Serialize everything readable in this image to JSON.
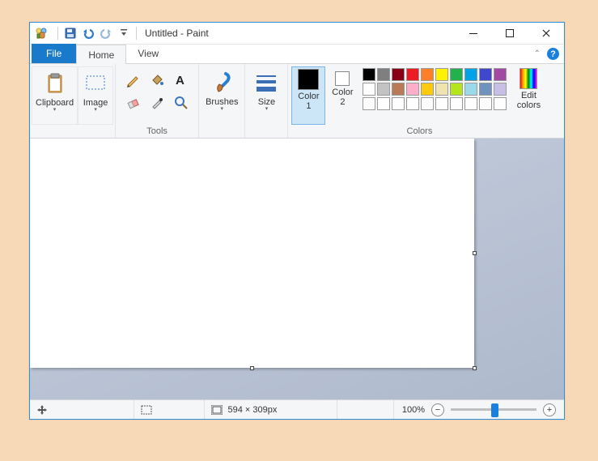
{
  "title": "Untitled - Paint",
  "tabs": {
    "file": "File",
    "home": "Home",
    "view": "View"
  },
  "ribbon": {
    "clipboard": {
      "label": "Clipboard"
    },
    "image": {
      "label": "Image"
    },
    "tools_group": "Tools",
    "brushes": "Brushes",
    "size": "Size",
    "color1": "Color\n1",
    "color2": "Color\n2",
    "colors_group": "Colors",
    "edit_colors": "Edit\ncolors"
  },
  "palette": {
    "row1": [
      "#000000",
      "#7f7f7f",
      "#880015",
      "#ed1c24",
      "#ff7f27",
      "#fff200",
      "#22b14c",
      "#00a2e8",
      "#3f48cc",
      "#a349a4"
    ],
    "row2": [
      "#ffffff",
      "#c3c3c3",
      "#b97a57",
      "#ffaec9",
      "#ffc90e",
      "#efe4b0",
      "#b5e61d",
      "#99d9ea",
      "#7092be",
      "#c8bfe7"
    ],
    "row3": [
      "",
      "",
      "",
      "",
      "",
      "",
      "",
      "",
      "",
      ""
    ]
  },
  "color1_value": "#000000",
  "color2_value": "#ffffff",
  "status": {
    "dimensions": "594 × 309px",
    "zoom": "100%"
  }
}
